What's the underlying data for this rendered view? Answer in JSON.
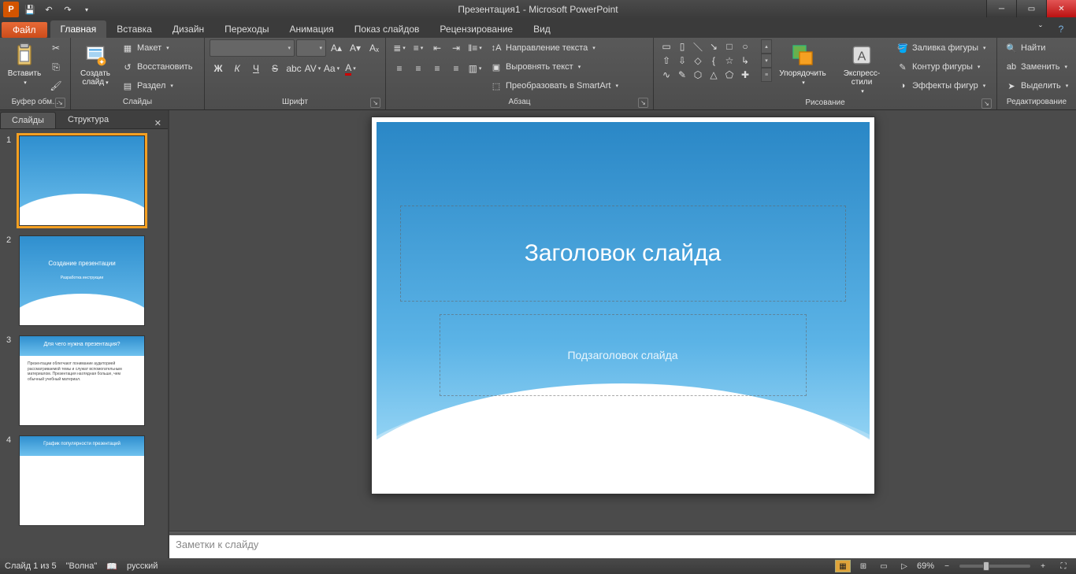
{
  "title": "Презентация1 - Microsoft PowerPoint",
  "qat": {
    "save": "💾",
    "undo": "↶",
    "redo": "↷"
  },
  "tabs": {
    "file": "Файл",
    "items": [
      "Главная",
      "Вставка",
      "Дизайн",
      "Переходы",
      "Анимация",
      "Показ слайдов",
      "Рецензирование",
      "Вид"
    ],
    "active_index": 0
  },
  "ribbon": {
    "clipboard": {
      "label": "Буфер обм...",
      "paste": "Вставить",
      "cut": "✂",
      "copy": "⎘",
      "fmtpaint": "🖌"
    },
    "slides": {
      "label": "Слайды",
      "new_slide": "Создать\nслайд",
      "layout": "Макет",
      "reset": "Восстановить",
      "section": "Раздел"
    },
    "font": {
      "label": "Шрифт",
      "family": "",
      "size": "",
      "bold": "Ж",
      "italic": "К",
      "underline": "Ч",
      "strike": "S",
      "shadow": "abc",
      "spacing": "AV",
      "case": "Aa",
      "color": "A"
    },
    "paragraph": {
      "label": "Абзац",
      "textdir": "Направление текста",
      "align": "Выровнять текст",
      "smartart": "Преобразовать в SmartArt"
    },
    "drawing": {
      "label": "Рисование",
      "arrange": "Упорядочить",
      "styles": "Экспресс-стили",
      "shapefill": "Заливка фигуры",
      "shapeoutline": "Контур фигуры",
      "shapeeffects": "Эффекты фигур"
    },
    "editing": {
      "label": "Редактирование",
      "find": "Найти",
      "replace": "Заменить",
      "select": "Выделить"
    }
  },
  "left": {
    "tab_slides": "Слайды",
    "tab_outline": "Структура",
    "thumbs": [
      {
        "n": "1",
        "title": ""
      },
      {
        "n": "2",
        "title": "Создание презентации",
        "sub": "Разработка инструкции"
      },
      {
        "n": "3",
        "title": "Для чего нужна презентация?",
        "body": "Презентации облегчают понимание аудиторией рассматриваемой темы и служат вспомогательным материалом. Презентация наглядная больше, чем обычный учебный материал."
      },
      {
        "n": "4",
        "title": "График популярности презентаций"
      }
    ],
    "selected": 0
  },
  "slide": {
    "title_ph": "Заголовок слайда",
    "subtitle_ph": "Подзаголовок слайда"
  },
  "notes": {
    "placeholder": "Заметки к слайду"
  },
  "status": {
    "slide_pos": "Слайд 1 из 5",
    "theme": "\"Волна\"",
    "lang": "русский",
    "zoom": "69%"
  }
}
